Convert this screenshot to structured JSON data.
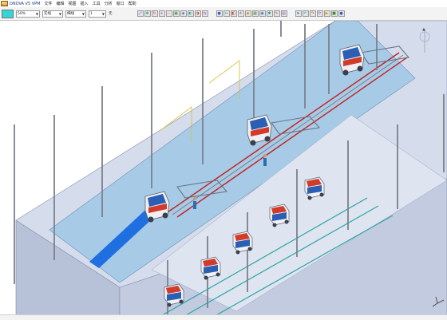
{
  "titlebar": {
    "logo": "File",
    "app_title": "DNOVA V5 VPM",
    "menu": [
      "文件",
      "编辑",
      "视图",
      "插入",
      "工具",
      "分析",
      "窗口",
      "帮助"
    ]
  },
  "toolbar": {
    "fill_color": "#33d6d6",
    "zoom_value": "50%",
    "linetype_value": "实线",
    "thickness_value": "细线",
    "layer_value": "1",
    "layer_label": "无",
    "view_icons": [
      "fit-all-icon",
      "pan-icon",
      "rotate-icon",
      "zoom-in-icon",
      "zoom-out-icon",
      "normal-view-icon",
      "iso-view-icon",
      "render-shading-icon",
      "hide-show-icon",
      "swap-space-icon"
    ],
    "render_icons": [
      "palette-icon",
      "measure-icon",
      "section-icon",
      "light-icon",
      "material-icon",
      "texture-icon",
      "camera-icon",
      "clash-icon",
      "annotation-icon",
      "grid-icon"
    ],
    "nav_icons": [
      "select-arrow-icon",
      "undo-icon",
      "redo-icon",
      "refresh-icon",
      "play-icon",
      "stop-icon",
      "record-icon"
    ]
  },
  "colors": {
    "floor_blue": "#a7cbe6",
    "platform_side": "#bcc6dc",
    "platform_top": "#d4dbeb",
    "accent_blue": "#1f6fe0",
    "rail_red": "#c21f1f",
    "lane_teal": "#2aa5a1"
  }
}
